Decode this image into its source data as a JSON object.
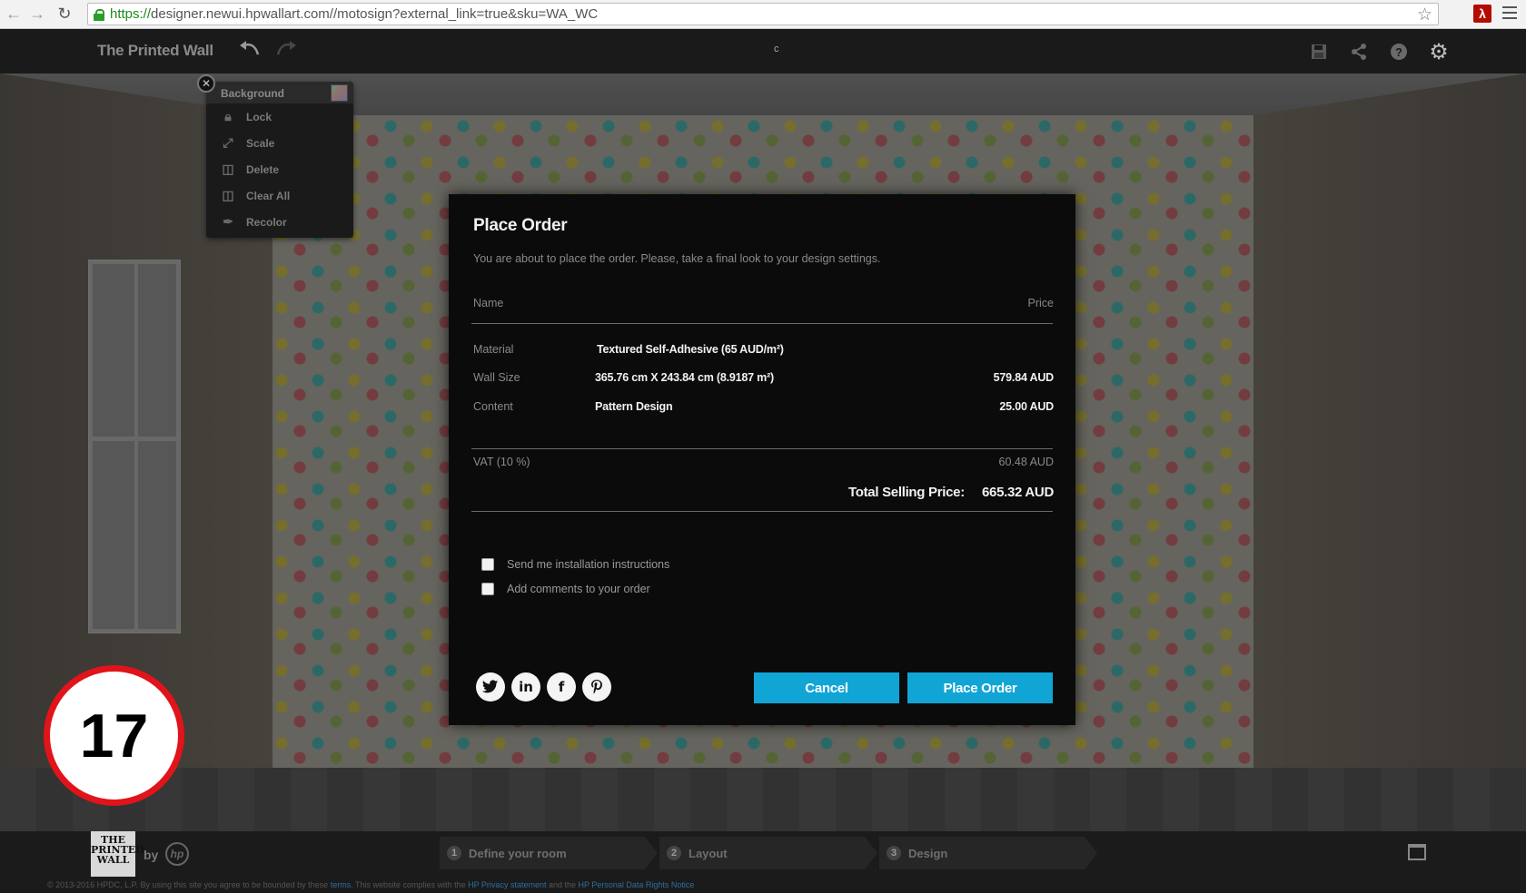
{
  "browser": {
    "url_scheme": "https://",
    "url_rest": "designer.newui.hpwallart.com//motosign?external_link=true&sku=WA_WC"
  },
  "app": {
    "title": "The Printed Wall",
    "center_marker": "c"
  },
  "context_menu": {
    "header": "Background",
    "items": [
      {
        "label": "Lock",
        "icon": "lock-icon"
      },
      {
        "label": "Scale",
        "icon": "scale-icon"
      },
      {
        "label": "Delete",
        "icon": "trash-icon"
      },
      {
        "label": "Clear All",
        "icon": "trash-icon"
      },
      {
        "label": "Recolor",
        "icon": "brush-icon"
      }
    ]
  },
  "modal": {
    "title": "Place Order",
    "subtitle": "You are about to place the order. Please, take a final look to your design settings.",
    "header_name": "Name",
    "header_price": "Price",
    "rows": [
      {
        "label": "Material",
        "value": "Textured Self-Adhesive  (65 AUD/m²)",
        "price": ""
      },
      {
        "label": "Wall Size",
        "value": "365.76 cm  X  243.84 cm  (8.9187 m²)",
        "price": "579.84 AUD"
      },
      {
        "label": "Content",
        "value": "Pattern Design",
        "price": "25.00 AUD"
      }
    ],
    "vat_label": "VAT  (10 %)",
    "vat_price": "60.48 AUD",
    "total_label": "Total Selling Price:",
    "total_price": "665.32 AUD",
    "options": [
      {
        "label": "Send me installation instructions",
        "checked": false
      },
      {
        "label": "Add comments to your order",
        "checked": false
      }
    ],
    "social": [
      "twitter-icon",
      "linkedin-icon",
      "facebook-icon",
      "pinterest-icon"
    ],
    "cancel_label": "Cancel",
    "place_label": "Place Order",
    "accent_color": "#11a5d6"
  },
  "step_badge": "17",
  "bottom": {
    "logo_text": "THE PRINTED WALL",
    "by": "by",
    "hp": "hp",
    "steps": [
      {
        "num": "1",
        "label": "Define your room"
      },
      {
        "num": "2",
        "label": "Layout"
      },
      {
        "num": "3",
        "label": "Design"
      }
    ],
    "footer_a": "© 2013-2016 HPDC, L.P.   By using this site you agree to be bounded by these",
    "footer_terms": "terms",
    "footer_b": ". This website complies with the",
    "footer_privacy": "HP Privacy statement",
    "footer_c": "and the",
    "footer_rights": "HP Personal Data Rights Notice"
  }
}
